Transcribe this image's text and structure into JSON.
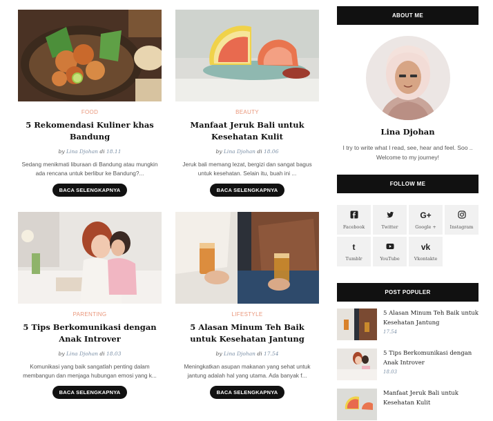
{
  "posts": [
    {
      "category": "FOOD",
      "title": "5 Rekomendasi Kuliner khas Bandung",
      "by": "by",
      "author": "Lina Djohan",
      "di": "di",
      "time": "18.11",
      "excerpt": "Sedang menikmati liburaan di Bandung atau mungkin ada rencana untuk berlibur ke Bandung?...",
      "button": "BACA SELENGKAPNYA"
    },
    {
      "category": "BEAUTY",
      "title": "Manfaat Jeruk Bali untuk Kesehatan Kulit",
      "by": "by",
      "author": "Lina Djohan",
      "di": "di",
      "time": "18.06",
      "excerpt": "Jeruk bali memang lezat, bergizi dan sangat bagus untuk kesehatan. Selain itu, buah ini ...",
      "button": "BACA SELENGKAPNYA"
    },
    {
      "category": "PARENTING",
      "title": "5 Tips Berkomunikasi dengan Anak Introver",
      "by": "by",
      "author": "Lina Djohan",
      "di": "di",
      "time": "18.03",
      "excerpt": "Komunikasi yang baik sangatlah penting dalam membangun dan menjaga hubungan emosi yang k...",
      "button": "BACA SELENGKAPNYA"
    },
    {
      "category": "LIFESTYLE",
      "title": "5 Alasan Minum Teh Baik untuk Kesehatan Jantung",
      "by": "by",
      "author": "Lina Djohan",
      "di": "di",
      "time": "17.54",
      "excerpt": "Meningkatkan asupan makanan yang sehat untuk jantung adalah hal yang utama. Ada banyak f...",
      "button": "BACA SELENGKAPNYA"
    }
  ],
  "sidebar": {
    "about": {
      "heading": "ABOUT ME",
      "name": "Lina Djohan",
      "bio": "I try to write what I read, see, hear and feel. Soo .. Welcome to my journey!"
    },
    "follow": {
      "heading": "FOLLOW ME",
      "items": [
        {
          "label": "Facebook",
          "icon": "facebook-icon",
          "glyph": "f"
        },
        {
          "label": "Twitter",
          "icon": "twitter-icon",
          "glyph": ""
        },
        {
          "label": "Google +",
          "icon": "google-plus-icon",
          "glyph": "G+"
        },
        {
          "label": "Instagram",
          "icon": "instagram-icon",
          "glyph": ""
        },
        {
          "label": "Tumblr",
          "icon": "tumblr-icon",
          "glyph": "t"
        },
        {
          "label": "YouTube",
          "icon": "youtube-icon",
          "glyph": ""
        },
        {
          "label": "Vkontakte",
          "icon": "vk-icon",
          "glyph": "vk"
        }
      ]
    },
    "popular": {
      "heading": "POST POPULER",
      "items": [
        {
          "title": "5 Alasan Minum Teh Baik untuk Kesehatan Jantung",
          "time": "17.54"
        },
        {
          "title": "5 Tips Berkomunikasi dengan Anak Introver",
          "time": "18.03"
        },
        {
          "title": "Manfaat Jeruk Bali untuk Kesehatan Kulit",
          "time": ""
        }
      ]
    }
  },
  "colors": {
    "accent": "#e9967a",
    "dark": "#111111",
    "meta": "#7a8fa6",
    "social_bg": "#f1f1f1"
  }
}
